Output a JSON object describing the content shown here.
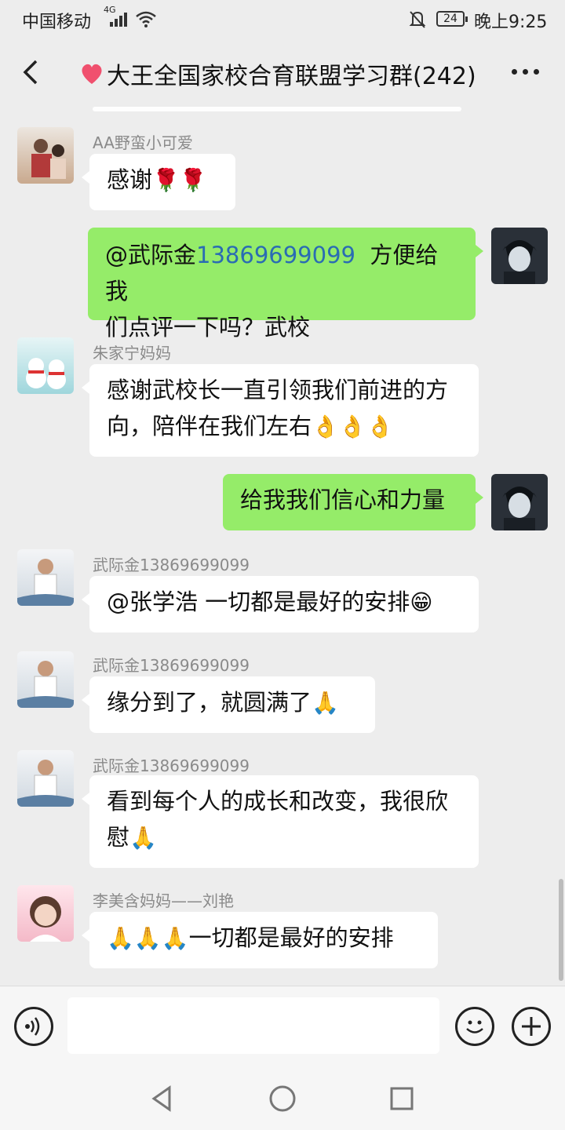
{
  "status_bar": {
    "carrier": "中国移动",
    "network": "4G",
    "battery": "24",
    "time": "晚上9:25"
  },
  "header": {
    "title": "大王全国家校合育联盟学习群(242)"
  },
  "messages": [
    {
      "sender": "AA野蛮小可爱",
      "text": "感谢",
      "emoji": "🌹🌹"
    },
    {
      "sender": "",
      "mention": "@武际金",
      "phone": "13869699099",
      "text_line1": "方便给我",
      "text_line2": "们点评一下吗？武校"
    },
    {
      "sender": "朱家宁妈妈",
      "text_line1": "感谢武校长一直引领我们前进的方",
      "text_line2": "向，陪伴在我们左右",
      "emoji": "👌👌👌"
    },
    {
      "sender": "",
      "text": "给我我们信心和力量"
    },
    {
      "sender": "武际金13869699099",
      "text": "@张学浩  一切都是最好的安排",
      "emoji": "😁"
    },
    {
      "sender": "武际金13869699099",
      "text": "缘分到了，就圆满了",
      "emoji": "🙏"
    },
    {
      "sender": "武际金13869699099",
      "text_line1": "看到每个人的成长和改变，我很欣",
      "text_line2": "慰",
      "emoji": "🙏"
    },
    {
      "sender": "李美含妈妈——刘艳",
      "emoji": "🙏🙏🙏",
      "text": "一切都是最好的安排"
    }
  ],
  "icons": {
    "back": "chevron-left-icon",
    "more": "more-dots-icon",
    "voice": "voice-icon",
    "emoji": "smiley-icon",
    "plus": "plus-icon",
    "heart": "heart-icon"
  },
  "colors": {
    "my_bubble": "#95ec69",
    "other_bubble": "#ffffff",
    "background": "#ededed",
    "link": "#2a6cb3"
  }
}
